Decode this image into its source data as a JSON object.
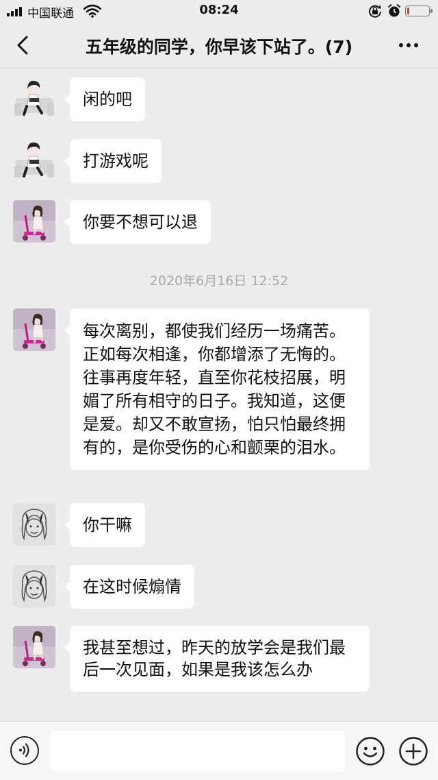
{
  "status_bar": {
    "carrier": "中国联通",
    "time": "08:24",
    "battery_level": 0.08
  },
  "nav": {
    "title": "五年级的同学，你早该下站了。(7)"
  },
  "messages": [
    {
      "avatar": "boy-reading-avatar",
      "text": "闲的吧"
    },
    {
      "avatar": "boy-reading-avatar",
      "text": "打游戏呢"
    },
    {
      "avatar": "girl-scooter-avatar",
      "text": "你要不想可以退"
    },
    {
      "avatar": "girl-scooter-avatar",
      "text": "每次离别，都使我们经历一场痛苦。正如每次相逢，你都增添了无悔的。往事再度年轻，直至你花枝招展，明媚了所有相守的日子。我知道，这便是爱。却又不敢宣扬，怕只怕最终拥有的，是你受伤的心和颤栗的泪水。"
    },
    {
      "avatar": "sketch-face-avatar",
      "text": "你干嘛"
    },
    {
      "avatar": "sketch-face-avatar",
      "text": "在这时候煽情"
    },
    {
      "avatar": "girl-scooter-avatar",
      "text": "我甚至想过，昨天的放学会是我们最后一次见面，如果是我该怎么办"
    }
  ],
  "timestamp": "2020年6月16日 12:52",
  "input": {
    "value": "",
    "placeholder": ""
  },
  "colors": {
    "background": "#ededed",
    "bubble": "#ffffff",
    "timestamp": "#a9a9a9",
    "battery_low": "#e53935"
  }
}
